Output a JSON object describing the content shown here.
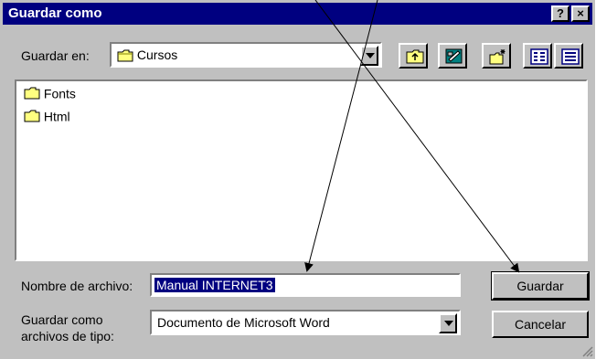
{
  "window": {
    "title": "Guardar como",
    "help_label": "?",
    "close_label": "×"
  },
  "location": {
    "label": "Guardar en:",
    "value": "Cursos"
  },
  "toolbar": {
    "tools": [
      "up-one-level-icon",
      "desktop-icon",
      "new-folder-icon",
      "list-view-icon",
      "details-view-icon"
    ]
  },
  "files": [
    {
      "name": "Fonts",
      "icon": "folder-icon"
    },
    {
      "name": "Html",
      "icon": "folder-icon"
    }
  ],
  "filename": {
    "label": "Nombre de archivo:",
    "value": "Manual INTERNET3"
  },
  "filetype": {
    "label_line1": "Guardar como",
    "label_line2": "archivos de tipo:",
    "value": "Documento de Microsoft Word"
  },
  "buttons": {
    "save": "Guardar",
    "cancel": "Cancelar"
  },
  "colors": {
    "titlebar": "#000080",
    "face": "#c0c0c0",
    "selection": "#000080"
  }
}
